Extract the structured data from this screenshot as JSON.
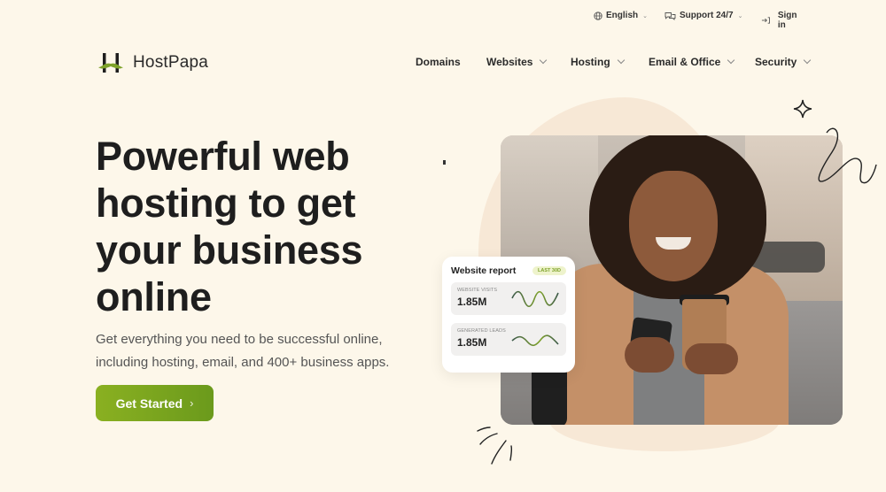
{
  "utility_bar": {
    "language": "English",
    "support": "Support 24/7",
    "sign_in": "Sign in"
  },
  "brand": {
    "name": "HostPapa",
    "accent_color": "#7ea22a"
  },
  "nav": {
    "items": [
      {
        "label": "Domains",
        "has_dropdown": false
      },
      {
        "label": "Websites",
        "has_dropdown": true
      },
      {
        "label": "Hosting",
        "has_dropdown": true
      },
      {
        "label": "Email & Office",
        "has_dropdown": true
      },
      {
        "label": "Security",
        "has_dropdown": true
      }
    ]
  },
  "hero": {
    "headline": "Powerful web hosting to get your business online",
    "subtext": "Get everything you need to be successful online, including hosting, email, and 400+ business apps.",
    "cta_label": "Get Started",
    "cta_arrow": "›"
  },
  "report_card": {
    "title": "Website report",
    "badge": "LAST 30D",
    "metrics": [
      {
        "label": "WEBSITE VISITS",
        "value": "1.85M"
      },
      {
        "label": "GENERATED LEADS",
        "value": "1.85M"
      }
    ]
  }
}
